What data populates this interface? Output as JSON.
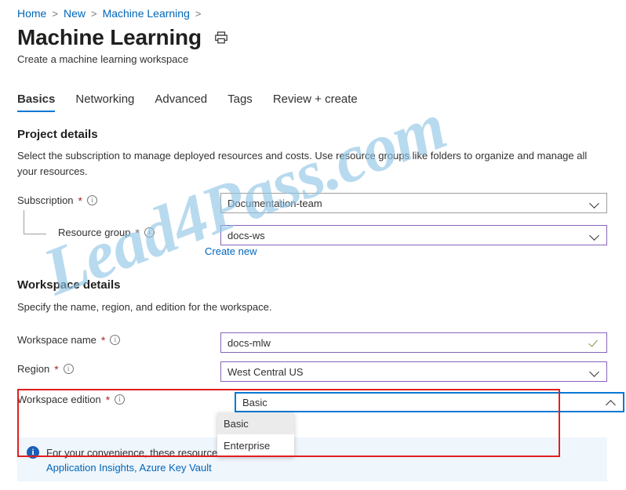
{
  "breadcrumb": {
    "items": [
      "Home",
      "New",
      "Machine Learning"
    ],
    "separator": ">"
  },
  "header": {
    "title": "Machine Learning",
    "subtitle": "Create a machine learning workspace",
    "print_icon": "printer-icon"
  },
  "tabs": [
    {
      "label": "Basics",
      "active": true
    },
    {
      "label": "Networking",
      "active": false
    },
    {
      "label": "Advanced",
      "active": false
    },
    {
      "label": "Tags",
      "active": false
    },
    {
      "label": "Review + create",
      "active": false
    }
  ],
  "project_details": {
    "title": "Project details",
    "description": "Select the subscription to manage deployed resources and costs. Use resource groups like folders to organize and manage all your resources.",
    "fields": {
      "subscription": {
        "label": "Subscription",
        "required": "*",
        "info_icon": "info-circle-icon",
        "value": "Documentation-team",
        "chevron": "chevron-down-icon",
        "border_color": "#a19f9d"
      },
      "resource_group": {
        "label": "Resource group",
        "required": "*",
        "info_icon": "info-circle-icon",
        "value": "docs-ws",
        "chevron": "chevron-down-icon",
        "border_color": "#8764b8",
        "create_new_link": "Create new"
      }
    }
  },
  "workspace_details": {
    "title": "Workspace details",
    "description": "Specify the name, region, and edition for the workspace.",
    "fields": {
      "workspace_name": {
        "label": "Workspace name",
        "required": "*",
        "info_icon": "info-circle-icon",
        "value": "docs-mlw",
        "valid_icon": "checkmark-icon",
        "border_color": "#8764b8"
      },
      "region": {
        "label": "Region",
        "required": "*",
        "info_icon": "info-circle-icon",
        "value": "West Central US",
        "chevron": "chevron-down-icon",
        "border_color": "#8764b8"
      },
      "workspace_edition": {
        "label": "Workspace edition",
        "required": "*",
        "info_icon": "info-circle-icon",
        "value": "Basic",
        "chevron": "chevron-up-icon",
        "border_color": "#0078d4",
        "expanded": true,
        "options": [
          {
            "label": "Basic",
            "selected": true
          },
          {
            "label": "Enterprise",
            "selected": false
          }
        ]
      }
    }
  },
  "info_banner": {
    "icon": "info-filled-icon",
    "text": "For your convenience, these resources a",
    "links": "Application Insights, Azure Key Vault"
  },
  "annotation": {
    "color": "#e02020",
    "shape": "rectangle-highlight"
  },
  "watermark": {
    "text": "Lead4Pass.com",
    "color": "#8ec4e6"
  }
}
